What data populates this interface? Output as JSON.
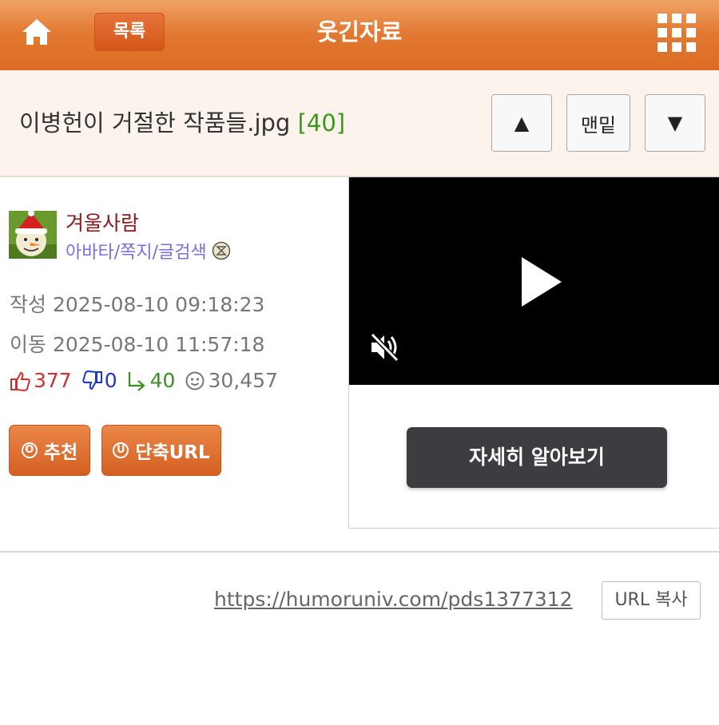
{
  "header": {
    "home_icon": "home-icon",
    "list_label": "목록",
    "title": "웃긴자료",
    "menu_icon": "grid-menu-icon"
  },
  "post": {
    "title": "이병헌이 거절한 작품들.jpg",
    "comment_count": "[40]",
    "nav": {
      "up_symbol": "▲",
      "bottom_label": "맨밑",
      "down_symbol": "▼"
    }
  },
  "author": {
    "name": "겨울사람",
    "links": "아바타/쪽지/글검색",
    "written": "작성 2025-08-10 09:18:23",
    "moved": "이동 2025-08-10 11:57:18"
  },
  "stats": {
    "upvotes": "377",
    "downvotes": "0",
    "replies": "40",
    "views": "30,457"
  },
  "actions": {
    "recommend_label": "추천",
    "recommend_symbol": "O",
    "shorturl_label": "단축URL",
    "shorturl_symbol": "U"
  },
  "ad": {
    "learn_more": "자세히 알아보기"
  },
  "share": {
    "url": "https://humoruniv.com/pds1377312",
    "copy_label": "URL 복사"
  },
  "colors": {
    "header_orange": "#e27a34",
    "author_name": "#8b1a1a",
    "link_purple": "#7b6fe0",
    "upvote_red": "#d32f2f",
    "downvote_blue": "#1f37c8",
    "reply_green": "#3b8f1e"
  }
}
